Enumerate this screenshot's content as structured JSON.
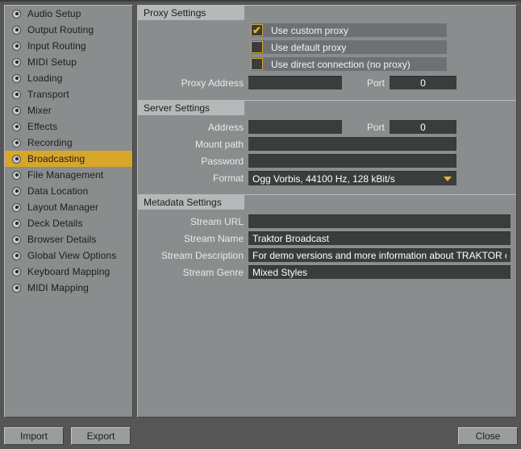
{
  "sidebar": {
    "items": [
      {
        "label": "Audio Setup",
        "selected": false
      },
      {
        "label": "Output Routing",
        "selected": false
      },
      {
        "label": "Input Routing",
        "selected": false
      },
      {
        "label": "MIDI Setup",
        "selected": false
      },
      {
        "label": "Loading",
        "selected": false
      },
      {
        "label": "Transport",
        "selected": false
      },
      {
        "label": "Mixer",
        "selected": false
      },
      {
        "label": "Effects",
        "selected": false
      },
      {
        "label": "Recording",
        "selected": false
      },
      {
        "label": "Broadcasting",
        "selected": true
      },
      {
        "label": "File Management",
        "selected": false
      },
      {
        "label": "Data Location",
        "selected": false
      },
      {
        "label": "Layout Manager",
        "selected": false
      },
      {
        "label": "Deck Details",
        "selected": false
      },
      {
        "label": "Browser Details",
        "selected": false
      },
      {
        "label": "Global View Options",
        "selected": false
      },
      {
        "label": "Keyboard Mapping",
        "selected": false
      },
      {
        "label": "MIDI Mapping",
        "selected": false
      }
    ]
  },
  "proxy_settings": {
    "title": "Proxy Settings",
    "checkboxes": [
      {
        "label": "Use custom proxy",
        "checked": true,
        "mark": "✔"
      },
      {
        "label": "Use default proxy",
        "checked": false,
        "mark": ""
      },
      {
        "label": "Use direct connection (no proxy)",
        "checked": false,
        "mark": ""
      }
    ],
    "address_label": "Proxy Address",
    "address_value": "",
    "port_label": "Port",
    "port_value": "0"
  },
  "server_settings": {
    "title": "Server Settings",
    "address_label": "Address",
    "address_value": "",
    "port_label": "Port",
    "port_value": "0",
    "mount_path_label": "Mount path",
    "mount_path_value": "",
    "password_label": "Password",
    "password_value": "",
    "format_label": "Format",
    "format_value": "Ogg Vorbis, 44100 Hz, 128 kBit/s"
  },
  "metadata_settings": {
    "title": "Metadata Settings",
    "stream_url_label": "Stream URL",
    "stream_url_value": "",
    "stream_name_label": "Stream Name",
    "stream_name_value": "Traktor Broadcast",
    "stream_description_label": "Stream Description",
    "stream_description_value": "For demo versions and more information about TRAKTOR click here",
    "stream_genre_label": "Stream Genre",
    "stream_genre_value": "Mixed Styles"
  },
  "bottom_bar": {
    "import_label": "Import",
    "export_label": "Export",
    "close_label": "Close"
  },
  "colors": {
    "accent_gold": "#d8a72a",
    "panel_gray": "#8a8d8e",
    "field_dark": "#3b3d3d",
    "window_gray": "#565656"
  }
}
